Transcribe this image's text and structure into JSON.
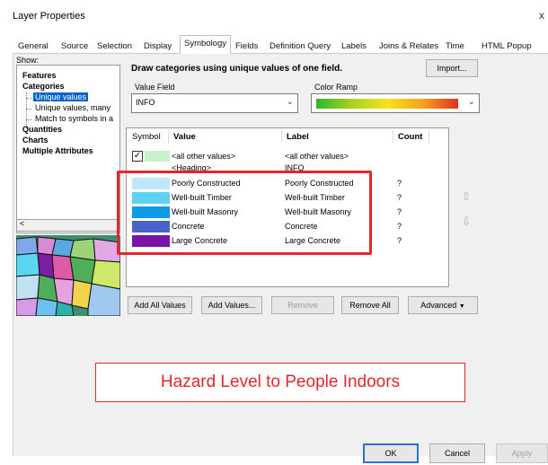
{
  "window": {
    "title": "Layer Properties",
    "close": "x"
  },
  "tabs": [
    "General",
    "Source",
    "Selection",
    "Display",
    "Symbology",
    "Fields",
    "Definition Query",
    "Labels",
    "Joins & Relates",
    "Time",
    "HTML Popup"
  ],
  "active_tab": "Symbology",
  "show": {
    "label": "Show:",
    "items": [
      "Features",
      "Categories",
      "Unique values",
      "Unique values, many",
      "Match to symbols in a",
      "Quantities",
      "Charts",
      "Multiple Attributes"
    ],
    "selected": "Unique values"
  },
  "main": {
    "heading": "Draw categories using unique values of one field.",
    "import_label": "Import...",
    "value_field_label": "Value Field",
    "value_field_value": "INFO",
    "color_ramp_label": "Color Ramp"
  },
  "table": {
    "headers": {
      "symbol": "Symbol",
      "value": "Value",
      "label": "Label",
      "count": "Count"
    },
    "rows": [
      {
        "value": "<all other values>",
        "label": "<all other values>",
        "count": "",
        "color": "#c9f1c9",
        "checked": true
      },
      {
        "value": "<Heading>",
        "label": "INFO",
        "count": "",
        "color": ""
      },
      {
        "value": "Poorly Constructed",
        "label": "Poorly Constructed",
        "count": "?",
        "color": "#bfe6fb"
      },
      {
        "value": "Well-built Timber",
        "label": "Well-built Timber",
        "count": "?",
        "color": "#5ed1f4"
      },
      {
        "value": "Well-built Masonry",
        "label": "Well-built Masonry",
        "count": "?",
        "color": "#0e9ae4"
      },
      {
        "value": "Concrete",
        "label": "Concrete",
        "count": "?",
        "color": "#4a63c9"
      },
      {
        "value": "Large Concrete",
        "label": "Large Concrete",
        "count": "?",
        "color": "#7a14a8"
      }
    ]
  },
  "buttons": {
    "add_all": "Add All Values",
    "add_values": "Add Values...",
    "remove": "Remove",
    "remove_all": "Remove All",
    "advanced": "Advanced",
    "ok": "OK",
    "cancel": "Cancel",
    "apply": "Apply"
  },
  "callout": "Hazard Level to People Indoors",
  "colors": {
    "highlight": "#e3282b",
    "selection": "#0a64c9"
  }
}
